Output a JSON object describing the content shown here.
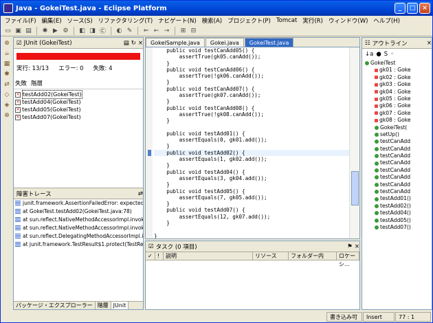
{
  "window": {
    "title": "Java - GokeiTest.java - Eclipse Platform"
  },
  "menu": [
    "ファイル(F)",
    "編集(E)",
    "ソース(S)",
    "リファクタリング(T)",
    "ナビゲート(N)",
    "検索(A)",
    "プロジェクト(P)",
    "Tomcat",
    "実行(R)",
    "ウィンドウ(W)",
    "ヘルプ(H)"
  ],
  "junit": {
    "tab_label": "JUnit (GokeiTest)",
    "status_color": "#e11",
    "runs": "実行: 13/13",
    "errors": "エラー: 0",
    "failures": "失敗: 4",
    "subtab_failures": "失敗",
    "subtab_hierarchy": "階層",
    "failed_tests": [
      "testAdd02(GokeiTest)",
      "testAdd04(GokeiTest)",
      "testAdd05(GokeiTest)",
      "testAdd07(GokeiTest)"
    ]
  },
  "trace": {
    "title": "障害トレース",
    "lines": [
      "junit.framework.AssertionFailedError: expected:<1> b",
      "at GokeiTest.testAdd02(GokeiTest.java:78)",
      "at sun.reflect.NativeMethodAccessorImpl.invoke0(N",
      "at sun.reflect.NativeMethodAccessorImpl.invoke(Ur",
      "at sun.reflect.DelegatingMethodAccessorImpl.invoke",
      "at junit.framework.TestResult$1.protect(TestResult."
    ]
  },
  "bottom_tabs": [
    "パッケージ・エクスプローラー",
    "階層",
    "JUnit"
  ],
  "editor": {
    "tabs": [
      "GokeiSample.java",
      "Gokei.java",
      "GokeiTest.java"
    ],
    "lines": [
      "    public void testCanAdd05() {",
      "        assertTrue(gk05.canAdd());",
      "    }",
      "    public void testCanAdd06() {",
      "        assertTrue(!gk06.canAdd());",
      "    }",
      "    public void testCanAdd07() {",
      "        assertTrue(gk07.canAdd());",
      "    }",
      "    public void testCanAdd08() {",
      "        assertTrue(!gk08.canAdd());",
      "    }",
      "",
      "    public void testAdd01() {",
      "        assertEquals(0, gk01.add());",
      "    }",
      "    public void testAdd02() {",
      "        assertEquals(1, gk02.add());",
      "    }",
      "    public void testAdd04() {",
      "        assertEquals(3, gk04.add());",
      "    }",
      "    public void testAdd05() {",
      "        assertEquals(7, gk05.add());",
      "    }",
      "    public void testAdd07() {",
      "        assertEquals(12, gk07.add());",
      "    }",
      "",
      "}"
    ]
  },
  "outline": {
    "title": "アウトライン",
    "items": [
      "GokeiTest",
      "gk01 : Goke",
      "gk02 : Goke",
      "gk03 : Goke",
      "gk04 : Goke",
      "gk05 : Goke",
      "gk06 : Goke",
      "gk07 : Goke",
      "gk08 : Goke",
      "GokeiTest(",
      "setUp()",
      "testCanAdd",
      "testCanAdd",
      "testCanAdd",
      "testCanAdd",
      "testCanAdd",
      "testCanAdd",
      "testCanAdd",
      "testCanAdd",
      "testAdd01()",
      "testAdd02()",
      "testAdd04()",
      "testAdd05()",
      "testAdd07()"
    ]
  },
  "tasks": {
    "title": "タスク (0 項目)",
    "columns": [
      "✓",
      "!",
      "説明",
      "リソース",
      "フォルダー内",
      "ロケーシ..."
    ]
  },
  "status": {
    "writable": "書き込み可能",
    "insert": "Insert",
    "position": "77 : 1"
  }
}
